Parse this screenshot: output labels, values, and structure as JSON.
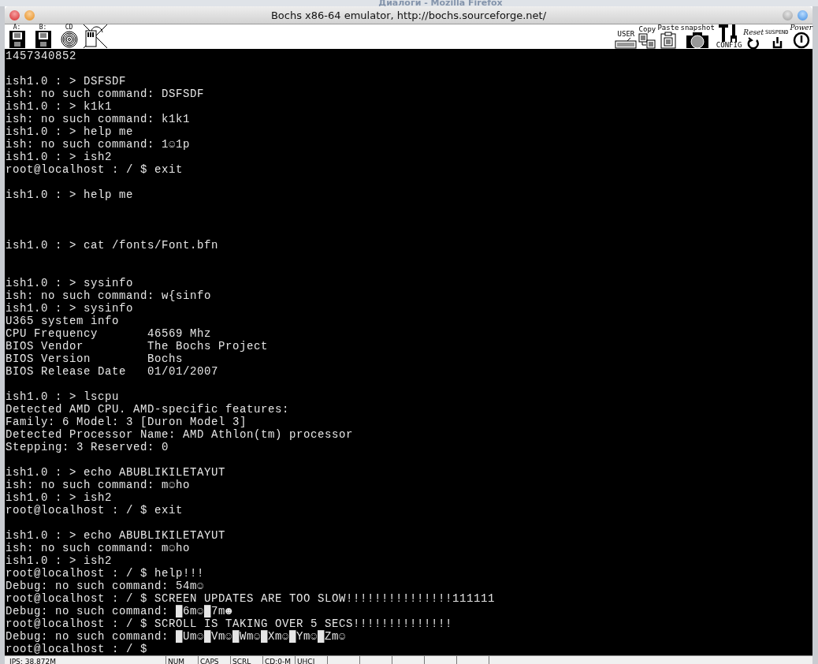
{
  "background_window": {
    "title": "Диалоги - Mozilla Firefox"
  },
  "window": {
    "title": "Bochs x86-64 emulator, http://bochs.sourceforge.net/"
  },
  "toolbar": {
    "left": [
      {
        "kind": "floppy",
        "label": "A:"
      },
      {
        "kind": "floppy",
        "label": "B:"
      },
      {
        "kind": "cdrom",
        "label": "CD"
      },
      {
        "kind": "mouse"
      }
    ],
    "right": [
      {
        "kind": "keyboard",
        "label": "USER"
      },
      {
        "kind": "copy",
        "label": "Copy"
      },
      {
        "kind": "paste",
        "label": "Paste"
      },
      {
        "kind": "snapshot",
        "label": "snapshot"
      },
      {
        "kind": "config",
        "label": "CONFIG"
      },
      {
        "kind": "reset",
        "label": "Reset"
      },
      {
        "kind": "suspend",
        "label": "SUSPEND"
      },
      {
        "kind": "power",
        "label": "Power"
      }
    ]
  },
  "terminal": {
    "lines": [
      {
        "text": "1457340852"
      },
      {
        "kind": "blank"
      },
      {
        "text": "ish1.0 : > DSFSDF"
      },
      {
        "text": "ish: no such command: DSFSDF"
      },
      {
        "text": "ish1.0 : > k1k1"
      },
      {
        "text": "ish: no such command: k1k1"
      },
      {
        "text": "ish1.0 : > help me"
      },
      {
        "text": "ish: no such command: 1☺1p"
      },
      {
        "text": "ish1.0 : > ish2"
      },
      {
        "text": "root@localhost : / $ exit"
      },
      {
        "kind": "blank"
      },
      {
        "text": "ish1.0 : > help me"
      },
      {
        "kind": "blank"
      },
      {
        "kind": "blank"
      },
      {
        "kind": "blank"
      },
      {
        "text": "ish1.0 : > cat /fonts/Font.bfn"
      },
      {
        "kind": "blank"
      },
      {
        "kind": "blank"
      },
      {
        "text": "ish1.0 : > sysinfo"
      },
      {
        "text": "ish: no such command: w{sinfo"
      },
      {
        "text": "ish1.0 : > sysinfo"
      },
      {
        "text": "U365 system info"
      },
      {
        "text": "CPU Frequency       46569 Mhz"
      },
      {
        "text": "BIOS Vendor         The Bochs Project"
      },
      {
        "text": "BIOS Version        Bochs"
      },
      {
        "text": "BIOS Release Date   01/01/2007"
      },
      {
        "kind": "blank"
      },
      {
        "text": "ish1.0 : > lscpu"
      },
      {
        "text": "Detected AMD CPU. AMD-specific features:"
      },
      {
        "text": "Family: 6 Model: 3 [Duron Model 3]"
      },
      {
        "text": "Detected Processor Name: AMD Athlon(tm) processor"
      },
      {
        "text": "Stepping: 3 Reserved: 0"
      },
      {
        "kind": "blank"
      },
      {
        "text": "ish1.0 : > echo ABUBLIKILETAYUT"
      },
      {
        "text": "ish: no such command: m☺ho"
      },
      {
        "text": "ish1.0 : > ish2"
      },
      {
        "text": "root@localhost : / $ exit"
      },
      {
        "kind": "blank"
      },
      {
        "text": "ish1.0 : > echo ABUBLIKILETAYUT"
      },
      {
        "text": "ish: no such command: m☺ho"
      },
      {
        "text": "ish1.0 : > ish2"
      },
      {
        "text": "root@localhost : / $ help!!!"
      },
      {
        "text": "Debug: no such command: 54m☺"
      },
      {
        "text": "root@localhost : / $ SCREEN UPDATES ARE TOO SLOW!!!!!!!!!!!!!!!111111"
      },
      {
        "text": "Debug: no such command: █6m☺█7m☻"
      },
      {
        "text": "root@localhost : / $ SCROLL IS TAKING OVER 5 SECS!!!!!!!!!!!!!!"
      },
      {
        "text": "Debug: no such command: █Um☺█Vm☺█Wm☺█Xm☺█Ym☺█Zm☺"
      },
      {
        "text": "root@localhost : / $"
      }
    ]
  },
  "status_bar": {
    "ips": "IPS: 38.872M",
    "indicators": [
      "NUM",
      "CAPS",
      "SCRL",
      "CD:0-M",
      "UHCI"
    ]
  }
}
